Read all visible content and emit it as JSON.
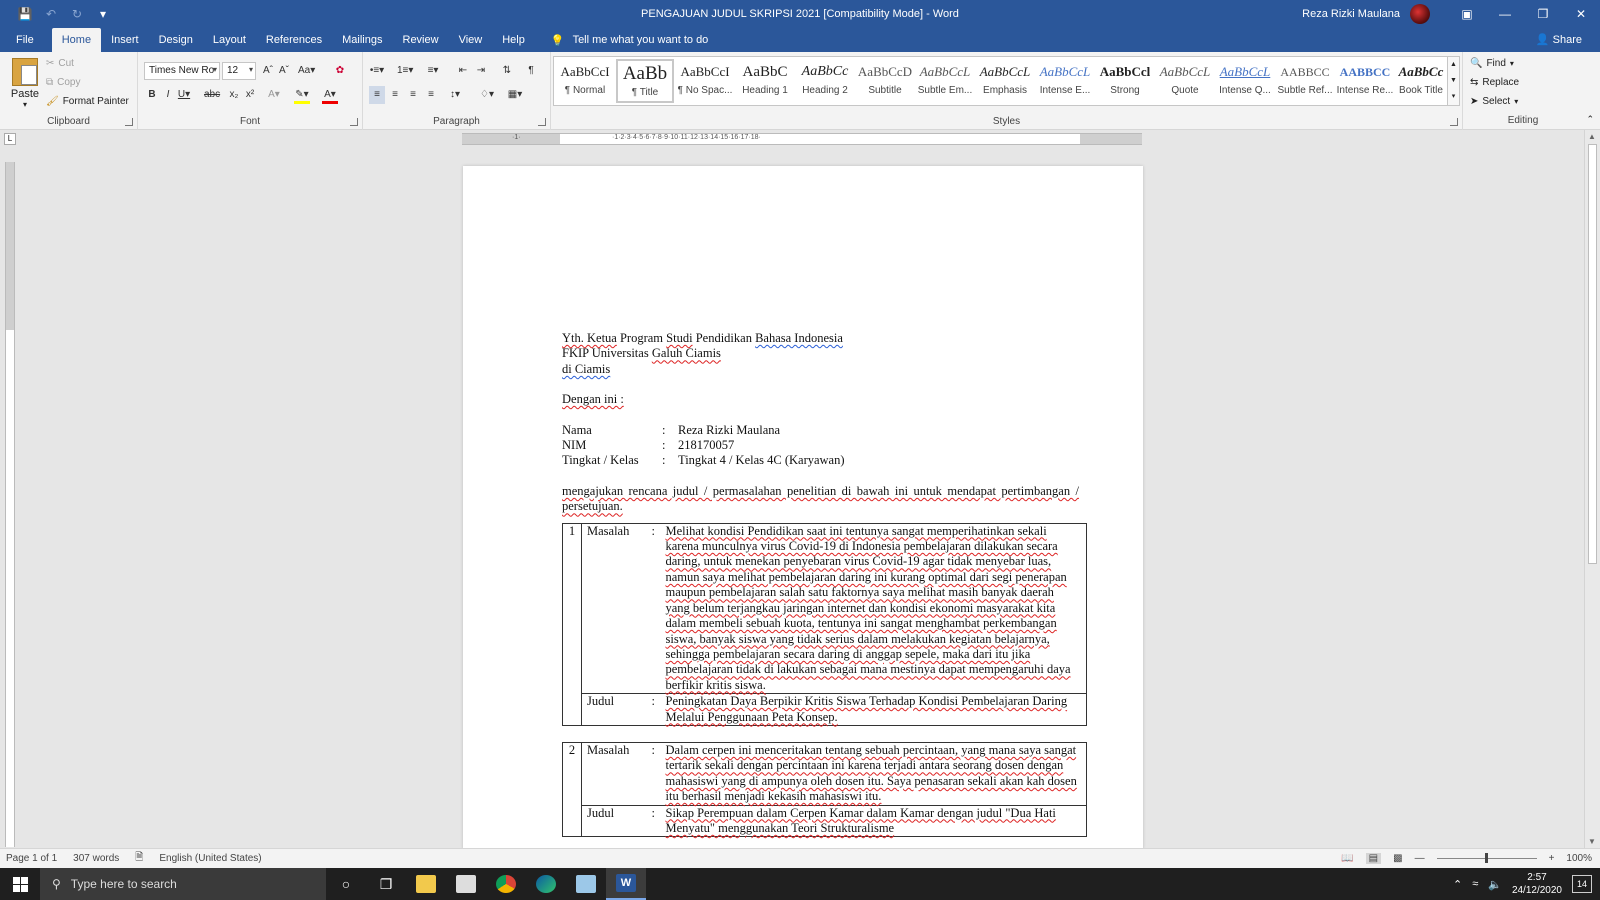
{
  "window": {
    "title": "PENGAJUAN JUDUL SKRIPSI 2021 [Compatibility Mode] - Word",
    "user": "Reza Rizki Maulana"
  },
  "tabs": [
    "File",
    "Home",
    "Insert",
    "Design",
    "Layout",
    "References",
    "Mailings",
    "Review",
    "View",
    "Help"
  ],
  "tell_me": "Tell me what you want to do",
  "share": "Share",
  "clipboard": {
    "paste": "Paste",
    "cut": "Cut",
    "copy": "Copy",
    "format_painter": "Format Painter",
    "label": "Clipboard"
  },
  "font": {
    "name": "Times New Ro",
    "size": "12",
    "label": "Font"
  },
  "paragraph": {
    "label": "Paragraph"
  },
  "styles": {
    "label": "Styles",
    "items": [
      {
        "sample": "AaBbCcI",
        "name": "¶ Normal"
      },
      {
        "sample": "AaBb",
        "name": "¶ Title"
      },
      {
        "sample": "AaBbCcI",
        "name": "¶ No Spac..."
      },
      {
        "sample": "AaBbC",
        "name": "Heading 1"
      },
      {
        "sample": "AaBbCc",
        "name": "Heading 2"
      },
      {
        "sample": "AaBbCcD",
        "name": "Subtitle"
      },
      {
        "sample": "AaBbCcL",
        "name": "Subtle Em..."
      },
      {
        "sample": "AaBbCcL",
        "name": "Emphasis"
      },
      {
        "sample": "AaBbCcL",
        "name": "Intense E..."
      },
      {
        "sample": "AaBbCcl",
        "name": "Strong"
      },
      {
        "sample": "AaBbCcL",
        "name": "Quote"
      },
      {
        "sample": "AaBbCcL",
        "name": "Intense Q..."
      },
      {
        "sample": "AABBCC",
        "name": "Subtle Ref..."
      },
      {
        "sample": "AABBCC",
        "name": "Intense Re..."
      },
      {
        "sample": "AaBbCc",
        "name": "Book Title"
      }
    ]
  },
  "editing": {
    "find": "Find",
    "replace": "Replace",
    "select": "Select",
    "label": "Editing"
  },
  "document": {
    "addr1_a": "Yth. Ketua",
    "addr1_b": " Program ",
    "addr1_c": "Studi",
    "addr1_d": " Pendidikan ",
    "addr1_e": "Bahasa  Indonesia",
    "addr2_a": "FKIP Universitas ",
    "addr2_b": "Galuh Ciamis",
    "addr3": "di  Ciamis",
    "intro": "Dengan ini :",
    "fields": [
      {
        "key": "Nama",
        "value": "Reza Rizki Maulana"
      },
      {
        "key": "NIM",
        "value": "218170057"
      },
      {
        "key": "Tingkat / Kelas",
        "value": "Tingkat 4 / Kelas 4C (Karyawan)"
      }
    ],
    "statement": "mengajukan rencana judul / permasalahan penelitian di bawah  ini untuk mendapat pertimbangan / persetujuan.",
    "entries": [
      {
        "no": "1",
        "masalah_label": "Masalah",
        "masalah": "Melihat kondisi Pendidikan saat ini tentunya sangat memperihatinkan sekali karena munculnya virus Covid-19 di Indonesia pembelajaran dilakukan secara daring, untuk menekan penyebaran virus Covid-19 agar tidak menyebar luas, namun saya melihat pembelajaran daring ini kurang optimal dari segi penerapan maupun pembelajaran salah satu faktornya saya melihat masih banyak daerah yang belum terjangkau jaringan internet dan kondisi ekonomi masyarakat kita dalam membeli sebuah kuota, tentunya ini sangat menghambat perkembangan siswa, banyak siswa yang tidak serius dalam melakukan kegiatan belajarnya, sehingga pembelajaran secara daring di anggap sepele, maka dari itu jika pembelajaran tidak di lakukan sebagai mana mestinya dapat mempengaruhi daya berfikir kritis siswa.",
        "judul_label": "Judul",
        "judul": "Peningkatan Daya Berpikir Kritis Siswa Terhadap Kondisi Pembelajaran Daring Melalui Penggunaan Peta Konsep."
      },
      {
        "no": "2",
        "masalah_label": "Masalah",
        "masalah": "Dalam cerpen ini menceritakan tentang sebuah percintaan, yang mana saya sangat tertarik sekali dengan percintaan ini karena terjadi antara seorang dosen dengan mahasiswi yang di ampunya oleh dosen itu. Saya penasaran sekali akan kah dosen itu berhasil menjadi kekasih mahasiswi itu.",
        "judul_label": "Judul",
        "judul": "Sikap Perempuan dalam Cerpen Kamar dalam Kamar dengan judul \"Dua Hati Menyatu\" menggunakan Teori Strukturalisme"
      }
    ]
  },
  "status": {
    "page": "Page 1 of 1",
    "words": "307 words",
    "language": "English (United States)",
    "zoom": "100%"
  },
  "taskbar": {
    "search_placeholder": "Type here to search",
    "time": "2:57",
    "date": "24/12/2020",
    "notifications": "14"
  }
}
